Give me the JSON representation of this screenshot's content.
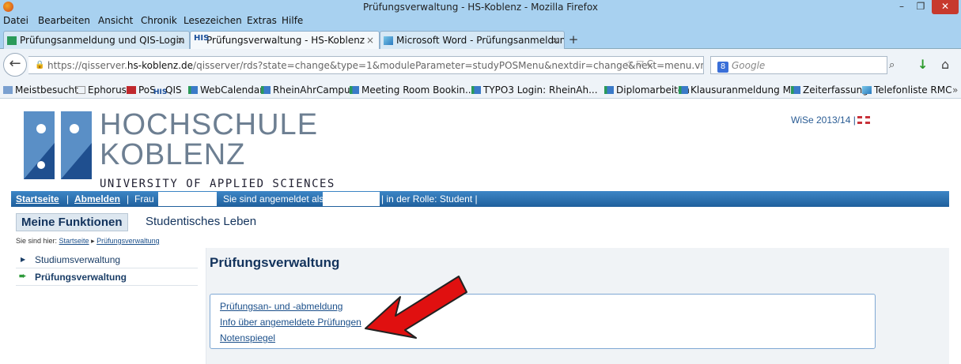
{
  "window": {
    "title": "Prüfungsverwaltung - HS-Koblenz - Mozilla Firefox"
  },
  "menu": [
    "Datei",
    "Bearbeiten",
    "Ansicht",
    "Chronik",
    "Lesezeichen",
    "Extras",
    "Hilfe"
  ],
  "tabs": [
    {
      "label": "Prüfungsanmeldung und QIS-Login"
    },
    {
      "label": "Prüfungsverwaltung - HS-Koblenz"
    },
    {
      "label": "Microsoft Word - Prüfungsanmeldun..."
    }
  ],
  "address": {
    "prefix": "https://qisserver.",
    "host": "hs-koblenz.de",
    "rest": "/qisserver/rds?state=change&type=1&moduleParameter=studyPOSMenu&nextdir=change&next=menu.vm&subdir=app"
  },
  "search": {
    "placeholder": "Google"
  },
  "bookmarks": [
    "Meistbesucht",
    "Ephorus",
    "PoS",
    "QIS",
    "WebCalendar",
    "RheinAhrCampus",
    "Meeting Room Bookin...",
    "TYPO3 Login: RheinAh...",
    "Diplomarbeiten",
    "Klausuranmeldung MT",
    "Zeiterfassung",
    "Telefonliste RMC"
  ],
  "logo": {
    "line1": "HOCHSCHULE",
    "line2": "KOBLENZ",
    "line3": "UNIVERSITY OF APPLIED SCIENCES"
  },
  "semester": "WiSe 2013/14 |",
  "userbar": {
    "start": "Startseite",
    "sep1": "|",
    "logout": "Abmelden",
    "sep2": "|",
    "frau": "Frau",
    "logged_in": "Sie sind angemeldet als:",
    "role": "| in der Rolle: Student |"
  },
  "section_tabs": {
    "mine": "Meine Funktionen",
    "student": "Studentisches Leben"
  },
  "breadcrumb": {
    "prefix": "Sie sind hier:",
    "home": "Startseite",
    "current": "Prüfungsverwaltung"
  },
  "leftnav": [
    {
      "label": "Studiumsverwaltung"
    },
    {
      "label": "Prüfungsverwaltung"
    }
  ],
  "content": {
    "title": "Prüfungsverwaltung",
    "links": [
      "Prüfungsan- und -abmeldung",
      "Info über angemeldete Prüfungen",
      "Notenspiegel"
    ]
  },
  "colors": {
    "bar": "#2a6fb0",
    "link": "#1b4f8a",
    "arrow": "#e01010"
  }
}
